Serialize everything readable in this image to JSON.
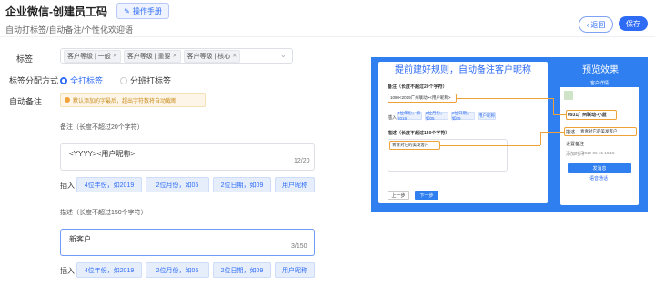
{
  "header": {
    "title": "企业微信-创建员工码",
    "manual_label": "操作手册",
    "breadcrumb": "自动打标签/自动备注/个性化欢迎语",
    "back_label": "返回",
    "save_label": "保存"
  },
  "form": {
    "tags_label": "标签",
    "tags": [
      "客户等级 | 一般",
      "客户等级 | 重要",
      "客户等级 | 核心"
    ],
    "assign_label": "标签分配方式",
    "assign_options": [
      "全打标签",
      "分班打标签"
    ],
    "assign_selected": "全打标签",
    "auto_note_label": "自动备注",
    "warning_text": "默认添加的字最后，超出字符数将自动截断",
    "note": {
      "label": "备注（长度不超过20个字符）",
      "value": "<YYYY><用户昵称>",
      "count": "12/20"
    },
    "desc": {
      "label": "描述（长度不超过150个字符）",
      "value": "新客户",
      "count": "3/150"
    },
    "insert_label": "插入",
    "insert_chips": [
      "4位年份，如2019",
      "2位月份，如05",
      "2位日期，如09",
      "用户昵称"
    ]
  },
  "preview": {
    "left_title": "提前建好规则，自动备注客户昵称",
    "right_title": "预览效果",
    "note_section": "备注（长度不超过20个字符）",
    "note_value": "1080<2019广州联动><用户昵称>",
    "desc_section": "描述（长度不超过150个字符）",
    "desc_value": "青青对它的美发客户",
    "insert_label": "插入",
    "mini_chips": [
      "4位年份，如2019",
      "2位月份，如05",
      "2位日期，如09",
      "用户昵称"
    ],
    "prev_label": "上一步",
    "next_label": "下一步",
    "phone_header": "客户详情",
    "phone_name": "0931广州联动-小蓝",
    "phone_desc": "青青对它的美发客户",
    "phone_desc_label": "描述",
    "phone_setting": "设置备注",
    "phone_time_label": "添加时间",
    "phone_time": "2019-06-15 16:15",
    "phone_send": "发消息",
    "phone_call": "语音通话"
  },
  "colors": {
    "primary": "#2f6cf5",
    "preview_bg": "#2f7ff0",
    "warning_bg": "#fdf6e8",
    "highlight": "#f0a23a"
  }
}
